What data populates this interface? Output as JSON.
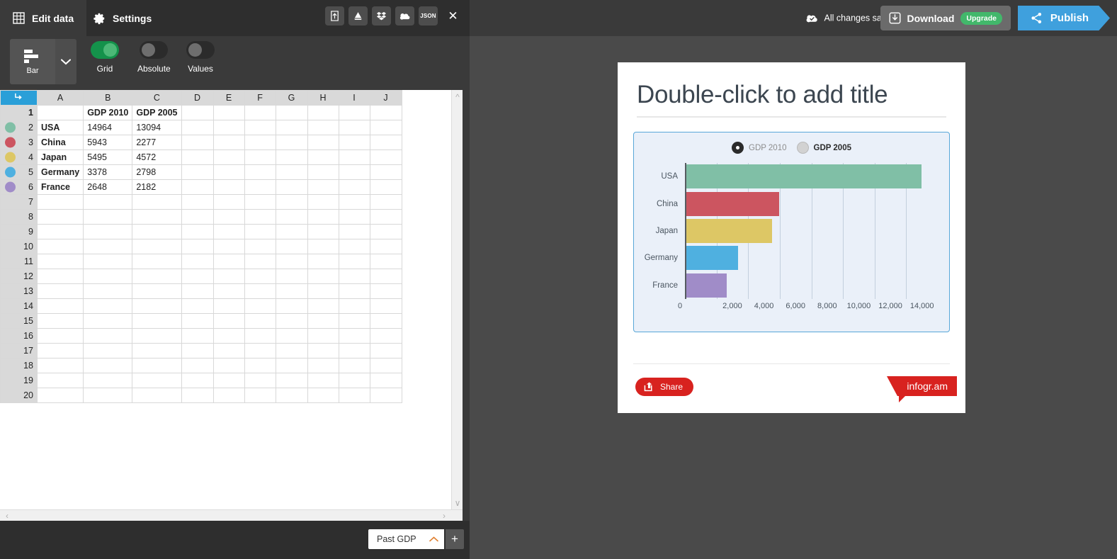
{
  "editor": {
    "tabs": [
      {
        "label": "Edit data",
        "icon": "table-icon",
        "active": true
      },
      {
        "label": "Settings",
        "icon": "gear-icon",
        "active": false
      }
    ],
    "import_icons": [
      {
        "name": "upload-icon",
        "label": ""
      },
      {
        "name": "google-drive-icon",
        "label": ""
      },
      {
        "name": "dropbox-icon",
        "label": ""
      },
      {
        "name": "onedrive-icon",
        "label": ""
      },
      {
        "name": "json-icon",
        "label": "JSON"
      }
    ],
    "close_label": "✕",
    "chart_type": {
      "label": "Bar",
      "caret": "⌄"
    },
    "toggles": [
      {
        "label": "Grid",
        "on": true
      },
      {
        "label": "Absolute",
        "on": false
      },
      {
        "label": "Values",
        "on": false
      }
    ],
    "sheet_tab": {
      "label": "Past GDP",
      "caret": "⌃"
    },
    "add_sheet_label": "+",
    "corner_icon": "select-all-icon"
  },
  "spreadsheet": {
    "columns": [
      "A",
      "B",
      "C",
      "D",
      "E",
      "F",
      "G",
      "H",
      "I",
      "J"
    ],
    "row_count": 20,
    "header_row": {
      "number": "1",
      "cells": [
        "",
        "GDP 2010",
        "GDP 2005",
        "",
        "",
        "",
        "",
        "",
        "",
        ""
      ]
    },
    "rows": [
      {
        "number": "2",
        "color": "#80bfa6",
        "cells": [
          "USA",
          "14964",
          "13094",
          "",
          "",
          "",
          "",
          "",
          "",
          ""
        ]
      },
      {
        "number": "3",
        "color": "#cc5560",
        "cells": [
          "China",
          "5943",
          "2277",
          "",
          "",
          "",
          "",
          "",
          "",
          ""
        ]
      },
      {
        "number": "4",
        "color": "#ddc765",
        "cells": [
          "Japan",
          "5495",
          "4572",
          "",
          "",
          "",
          "",
          "",
          "",
          ""
        ]
      },
      {
        "number": "5",
        "color": "#4fb0e0",
        "cells": [
          "Germany",
          "3378",
          "2798",
          "",
          "",
          "",
          "",
          "",
          "",
          ""
        ]
      },
      {
        "number": "6",
        "color": "#a08cc8",
        "cells": [
          "France",
          "2648",
          "2182",
          "",
          "",
          "",
          "",
          "",
          "",
          ""
        ]
      }
    ],
    "empty_rows": [
      "7",
      "8",
      "9",
      "10",
      "11",
      "12",
      "13",
      "14",
      "15",
      "16",
      "17",
      "18",
      "19",
      "20"
    ]
  },
  "topbar": {
    "saved_text": "All changes saved",
    "saved_icon": "cloud-check-icon",
    "download_label": "Download",
    "download_icon": "download-icon",
    "upgrade_label": "Upgrade",
    "publish_label": "Publish",
    "publish_icon": "share-nodes-icon"
  },
  "card": {
    "title": "Double-click to add title",
    "share_label": "Share",
    "share_icon": "share-box-icon",
    "brand_label": "infogr.am"
  },
  "chart_data": {
    "type": "bar",
    "orientation": "horizontal",
    "title": "",
    "xlabel": "",
    "ylabel": "",
    "categories": [
      "USA",
      "China",
      "Japan",
      "Germany",
      "France"
    ],
    "series": [
      {
        "name": "GDP 2010",
        "active": true,
        "values": [
          14964,
          5943,
          5495,
          3378,
          2648
        ]
      },
      {
        "name": "GDP 2005",
        "active": false,
        "values": [
          13094,
          2277,
          4572,
          2798,
          2182
        ]
      }
    ],
    "bar_colors": [
      "#80bfa6",
      "#cc5560",
      "#ddc765",
      "#4fb0e0",
      "#a08cc8"
    ],
    "xticks": [
      "0",
      "2,000",
      "4,000",
      "6,000",
      "8,000",
      "10,000",
      "12,000",
      "14,000"
    ],
    "xtick_values": [
      0,
      2000,
      4000,
      6000,
      8000,
      10000,
      12000,
      14000
    ],
    "xlim": [
      0,
      16000
    ],
    "grid": true,
    "legend_position": "top",
    "plot_bg": "#eaf0f9",
    "border_color": "#58a7d8"
  }
}
